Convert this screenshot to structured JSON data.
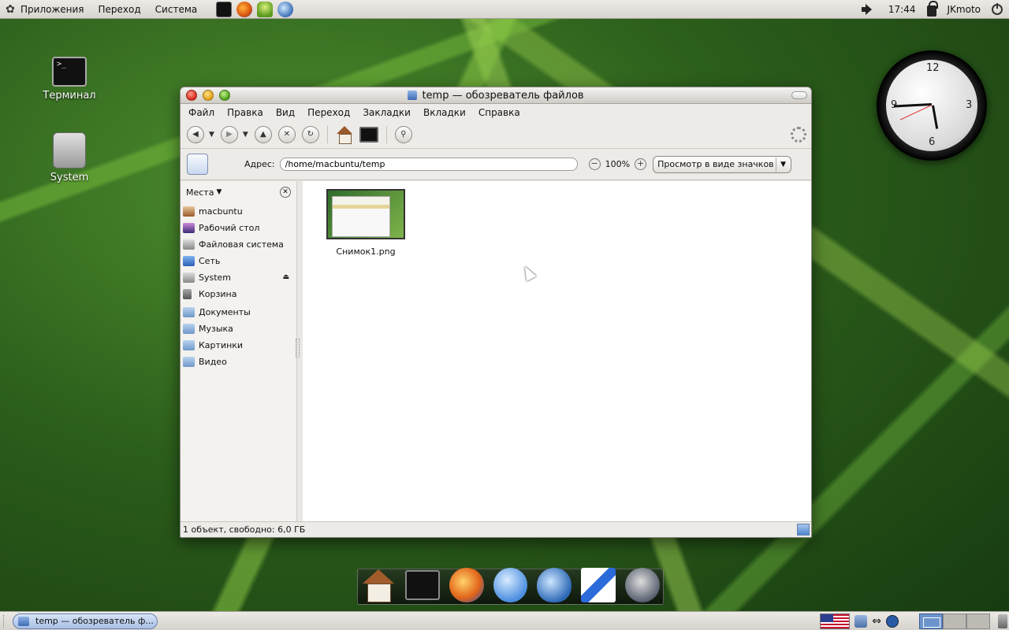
{
  "top_panel": {
    "menus": [
      "Приложения",
      "Переход",
      "Система"
    ],
    "time": "17:44",
    "user": "JKmoto"
  },
  "desktop": {
    "icons": [
      {
        "label": "Терминал",
        "icon": "terminal-icon"
      },
      {
        "label": "System",
        "icon": "hard-disk-icon"
      }
    ],
    "clock_numbers": [
      "12",
      "3",
      "6",
      "9"
    ]
  },
  "window": {
    "title": "temp — обозреватель файлов",
    "menu": [
      "Файл",
      "Правка",
      "Вид",
      "Переход",
      "Закладки",
      "Вкладки",
      "Справка"
    ],
    "location": {
      "label": "Адрес:",
      "path": "/home/macbuntu/temp",
      "zoom": "100%",
      "view_mode": "Просмотр в виде значков"
    },
    "sidebar": {
      "header": "Места",
      "items": [
        {
          "label": "macbuntu",
          "icon": "home-icon"
        },
        {
          "label": "Рабочий стол",
          "icon": "desktop-icon"
        },
        {
          "label": "Файловая система",
          "icon": "filesystem-icon"
        },
        {
          "label": "Сеть",
          "icon": "network-icon"
        },
        {
          "label": "System",
          "icon": "drive-icon"
        },
        {
          "label": "Корзина",
          "icon": "trash-icon"
        },
        {
          "label": "Документы",
          "icon": "folder-icon"
        },
        {
          "label": "Музыка",
          "icon": "folder-icon"
        },
        {
          "label": "Картинки",
          "icon": "folder-icon"
        },
        {
          "label": "Видео",
          "icon": "folder-icon"
        }
      ]
    },
    "files": [
      {
        "name": "Снимок1.png"
      }
    ],
    "status": "1 объект, свободно: 6,0 ГБ"
  },
  "dock": {
    "items": [
      "home-icon",
      "terminal-icon",
      "firefox-icon",
      "ichat-icon",
      "drop-icon",
      "quill-icon",
      "wolf-icon"
    ]
  },
  "bottom_panel": {
    "task": "temp — обозреватель ф..."
  }
}
